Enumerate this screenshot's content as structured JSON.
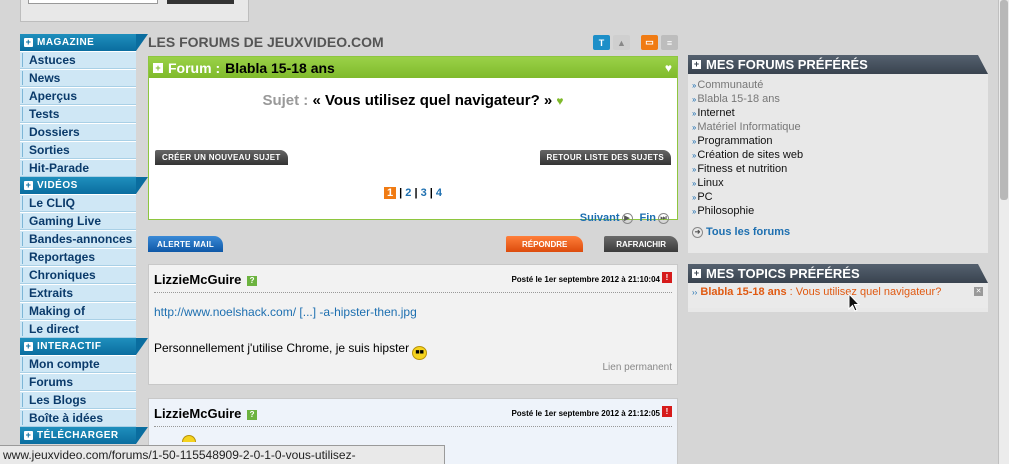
{
  "leftnav": {
    "sections": [
      {
        "title": "Magazine",
        "items": [
          "Astuces",
          "News",
          "Aperçus",
          "Tests",
          "Dossiers",
          "Sorties",
          "Hit-Parade"
        ]
      },
      {
        "title": "Vidéos",
        "items": [
          "Le CLIQ",
          "Gaming Live",
          "Bandes-annonces",
          "Reportages",
          "Chroniques",
          "Extraits",
          "Making of",
          "Le direct"
        ]
      },
      {
        "title": "Interactif",
        "items": [
          "Mon compte",
          "Forums",
          "Les Blogs",
          "Boîte à idées"
        ]
      },
      {
        "title": "Télécharger",
        "items": []
      }
    ]
  },
  "main": {
    "page_title": "LES FORUMS DE JEUXVIDEO.COM",
    "view_buttons": [
      "T",
      "img",
      "box",
      "list"
    ],
    "forum_label": "Forum :",
    "forum_name": "Blabla 15-18 ans",
    "subject_label": "Sujet :",
    "subject_title": "« Vous utilisez quel navigateur? »",
    "new_topic_button": "Créer un nouveau sujet",
    "back_list_button": "Retour liste des sujets",
    "pagination": {
      "current": "1",
      "pages": [
        "2",
        "3",
        "4"
      ]
    },
    "next_link": "Suivant",
    "end_link": "Fin",
    "alert_mail_button": "Alerte mail",
    "reply_button": "Répondre",
    "refresh_button": "Rafraichir",
    "posts": [
      {
        "author": "LizzieMcGuire",
        "date": "Posté le 1er septembre 2012 à 21:10:04",
        "link": "http://www.noelshack.com/ [...] -a-hipster-then.jpg",
        "text": "Personnellement j'utilise Chrome, je suis hipster",
        "permalink": "Lien permanent"
      },
      {
        "author": "LizzieMcGuire",
        "date": "Posté le 1er septembre 2012 à 21:12:05"
      }
    ]
  },
  "right": {
    "fav_forums_title": "Mes forums préférés",
    "fav_forums": [
      {
        "name": "Communauté",
        "style": "grey"
      },
      {
        "name": "Blabla 15-18 ans",
        "style": "grey"
      },
      {
        "name": "Internet",
        "style": "dark"
      },
      {
        "name": "Matériel Informatique",
        "style": "grey"
      },
      {
        "name": "Programmation",
        "style": "dark"
      },
      {
        "name": "Création de sites web",
        "style": "dark"
      },
      {
        "name": "Fitness et nutrition",
        "style": "dark"
      },
      {
        "name": "Linux",
        "style": "dark"
      },
      {
        "name": "PC",
        "style": "dark"
      },
      {
        "name": "Philosophie",
        "style": "dark"
      }
    ],
    "all_forums_link": "Tous les forums",
    "fav_topics_title": "Mes topics préférés",
    "fav_topic_forum": "Blabla 15-18 ans",
    "fav_topic_title": ": Vous utilisez quel navigateur?"
  },
  "status_bar": "www.jeuxvideo.com/forums/1-50-115548909-2-0-1-0-vous-utilisez-",
  "colors": {
    "nav_blue": "#0a6d9f",
    "forum_green": "#7fba2b",
    "accent_orange": "#f07b13",
    "link_blue": "#1d6fb0"
  }
}
